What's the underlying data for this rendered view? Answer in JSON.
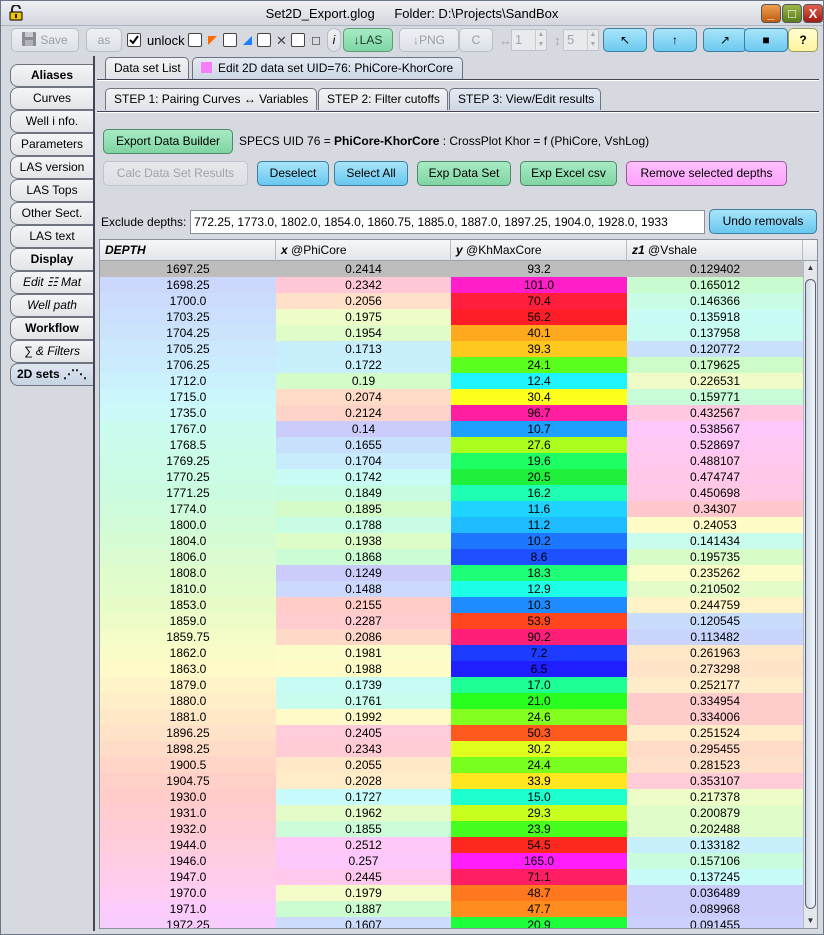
{
  "window": {
    "filename": "Set2D_Export.glog",
    "folder": "Folder: D:\\Projects\\SandBox",
    "controls": {
      "minimize": "_",
      "maximize": "□",
      "close": "X"
    }
  },
  "toolbar": {
    "save_label": "Save",
    "as_label": "as",
    "unlock_label": "unlock",
    "unlock_checked": true,
    "info_label": "i",
    "las_label": "↓LAS",
    "png_label": "↓PNG",
    "c_label": "C",
    "h_spin_icon": "↔",
    "h_spin_value": "1",
    "v_spin_icon": "↕",
    "v_spin_value": "5",
    "arrow_nw": "↖",
    "arrow_n": "↑",
    "arrow_ne": "↗",
    "square_outline": "□",
    "square_filled": "■",
    "help": "?"
  },
  "sidebar": {
    "items": [
      {
        "label": "Aliases",
        "style": "bold"
      },
      {
        "label": "Curves",
        "style": ""
      },
      {
        "label": "Well i nfo.",
        "style": ""
      },
      {
        "label": "Parameters",
        "style": ""
      },
      {
        "label": "LAS version",
        "style": ""
      },
      {
        "label": "LAS Tops",
        "style": ""
      },
      {
        "label": "Other Sect.",
        "style": ""
      },
      {
        "label": "LAS text",
        "style": ""
      },
      {
        "label": "Display",
        "style": "bold"
      },
      {
        "label": "Edit ☷ Mat",
        "style": "italic"
      },
      {
        "label": "Well path",
        "style": "italic"
      },
      {
        "label": "Workflow",
        "style": "bold"
      },
      {
        "label": "∑ & Filters",
        "style": "italic"
      },
      {
        "label": "2D sets ⋰⋱",
        "style": "bold",
        "selected": true
      }
    ]
  },
  "tabs": {
    "list_label": "Data set List",
    "edit_label": "Edit 2D data set UID=76: PhiCore-KhorCore",
    "edit_swatch_color": "#f77ef7"
  },
  "steps": {
    "step1": "STEP 1: Pairing Curves ↔ Variables",
    "step2": "STEP 2: Filter cutoffs",
    "step3": "STEP 3: View/Edit results"
  },
  "actions": {
    "export_builder": "Export Data Builder",
    "specs_prefix": "SPECS UID 76 = ",
    "specs_name": "PhiCore-KhorCore",
    "specs_suffix": " : CrossPlot Khor = f (PhiCore, VshLog)",
    "calc": "Calc Data Set Results",
    "deselect": "Deselect",
    "select_all": "Select All",
    "exp_data_set": "Exp Data Set",
    "exp_excel": "Exp Excel csv",
    "remove_selected": "Remove selected depths",
    "exclude_label": "Exclude depths:",
    "exclude_value": "772.25,  1773.0,  1802.0,  1854.0,  1860.75,  1885.0,  1887.0,  1897.25,  1904.0,  1928.0,  1933",
    "undo": "Undo removals"
  },
  "table": {
    "headers": [
      {
        "prefix": "DEPTH",
        "suffix": ""
      },
      {
        "prefix": "x",
        "suffix": " @PhiCore"
      },
      {
        "prefix": "y",
        "suffix": " @KhMaxCore"
      },
      {
        "prefix": "z1",
        "suffix": " @Vshale"
      }
    ],
    "rows": [
      {
        "depth": "1697.25",
        "x": "0.2414",
        "y": "93.2",
        "z": "0.129402",
        "dc": "#bdbdbd",
        "xc": "#bdbdbd",
        "yc": "#ff1e96",
        "zc": "#bdbdbd",
        "selected": true
      },
      {
        "depth": "1698.25",
        "x": "0.2342",
        "y": "101.0",
        "z": "0.165012",
        "dc": "#cbd8fc",
        "xc": "#ffc8d6",
        "yc": "#ff1ec8",
        "zc": "#c8fcd0"
      },
      {
        "depth": "1700.0",
        "x": "0.2056",
        "y": "70.4",
        "z": "0.146366",
        "dc": "#cbdcfc",
        "xc": "#ffe0c8",
        "yc": "#ff1e3c",
        "zc": "#c8fce4"
      },
      {
        "depth": "1703.25",
        "x": "0.1975",
        "y": "56.2",
        "z": "0.135918",
        "dc": "#cbe0fc",
        "xc": "#eefcc8",
        "yc": "#ff1e28",
        "zc": "#c8fcf4"
      },
      {
        "depth": "1704.25",
        "x": "0.1954",
        "y": "40.1",
        "z": "0.137958",
        "dc": "#cbe4fc",
        "xc": "#e0fcc8",
        "yc": "#ffaa1e",
        "zc": "#c8fcf0"
      },
      {
        "depth": "1705.25",
        "x": "0.1713",
        "y": "39.3",
        "z": "0.120772",
        "dc": "#cbe8fc",
        "xc": "#c8eefc",
        "yc": "#ffc81e",
        "zc": "#c8e0fc"
      },
      {
        "depth": "1706.25",
        "x": "0.1722",
        "y": "24.1",
        "z": "0.179625",
        "dc": "#cbecfc",
        "xc": "#c8f0fc",
        "yc": "#5aff1e",
        "zc": "#cefcc8"
      },
      {
        "depth": "1712.0",
        "x": "0.19",
        "y": "12.4",
        "z": "0.226531",
        "dc": "#cbf2fc",
        "xc": "#d4fcc8",
        "yc": "#1ef4ff",
        "zc": "#f0fcc8"
      },
      {
        "depth": "1715.0",
        "x": "0.2074",
        "y": "30.4",
        "z": "0.159771",
        "dc": "#cbf6fc",
        "xc": "#ffdcc8",
        "yc": "#ffff1e",
        "zc": "#c8fcd8"
      },
      {
        "depth": "1735.0",
        "x": "0.2124",
        "y": "96.7",
        "z": "0.432567",
        "dc": "#cbfaf8",
        "xc": "#ffd4c8",
        "yc": "#ff1ea0",
        "zc": "#ffc8e0"
      },
      {
        "depth": "1767.0",
        "x": "0.14",
        "y": "10.7",
        "z": "0.538567",
        "dc": "#cbfcf0",
        "xc": "#ccccfc",
        "yc": "#1ea0ff",
        "zc": "#ffc8fc"
      },
      {
        "depth": "1768.5",
        "x": "0.1655",
        "y": "27.6",
        "z": "0.528697",
        "dc": "#cbfcec",
        "xc": "#c8e0fc",
        "yc": "#aaff1e",
        "zc": "#ffc8f4"
      },
      {
        "depth": "1769.25",
        "x": "0.1704",
        "y": "19.6",
        "z": "0.488107",
        "dc": "#cbfce8",
        "xc": "#c8ecfc",
        "yc": "#1eff64",
        "zc": "#ffc8ec"
      },
      {
        "depth": "1770.25",
        "x": "0.1742",
        "y": "20.5",
        "z": "0.474747",
        "dc": "#cbfce4",
        "xc": "#c8fcf4",
        "yc": "#1ef03c",
        "zc": "#ffc8e8"
      },
      {
        "depth": "1771.25",
        "x": "0.1849",
        "y": "16.2",
        "z": "0.450698",
        "dc": "#cbfce0",
        "xc": "#c8fce0",
        "yc": "#1effb4",
        "zc": "#ffc8e4"
      },
      {
        "depth": "1774.0",
        "x": "0.1895",
        "y": "11.6",
        "z": "0.34307",
        "dc": "#cefcdc",
        "xc": "#d4fcc8",
        "yc": "#1ed4ff",
        "zc": "#ffc8cc"
      },
      {
        "depth": "1800.0",
        "x": "0.1788",
        "y": "11.2",
        "z": "0.24053",
        "dc": "#d2fcd8",
        "xc": "#c8fce4",
        "yc": "#1ebcff",
        "zc": "#fffcc8"
      },
      {
        "depth": "1804.0",
        "x": "0.1938",
        "y": "10.2",
        "z": "0.141434",
        "dc": "#d6fcd4",
        "xc": "#dcfcc8",
        "yc": "#1e78ff",
        "zc": "#c8fcec"
      },
      {
        "depth": "1806.0",
        "x": "0.1868",
        "y": "8.6",
        "z": "0.195735",
        "dc": "#dafcd0",
        "xc": "#ccfcd4",
        "yc": "#1e50ff",
        "zc": "#d8fcc8"
      },
      {
        "depth": "1808.0",
        "x": "0.1249",
        "y": "18.3",
        "z": "0.235262",
        "dc": "#defccc",
        "xc": "#ccccfc",
        "yc": "#1eff78",
        "zc": "#fcfcc8"
      },
      {
        "depth": "1810.0",
        "x": "0.1488",
        "y": "12.9",
        "z": "0.210502",
        "dc": "#e2fccc",
        "xc": "#ccd8fc",
        "yc": "#1effe8",
        "zc": "#e4fcc8"
      },
      {
        "depth": "1853.0",
        "x": "0.2155",
        "y": "10.3",
        "z": "0.244759",
        "dc": "#e8fcc8",
        "xc": "#ffccc8",
        "yc": "#1e8cff",
        "zc": "#fff4c8"
      },
      {
        "depth": "1859.0",
        "x": "0.2287",
        "y": "53.9",
        "z": "0.120545",
        "dc": "#eefcc8",
        "xc": "#ffccd0",
        "yc": "#ff461e",
        "zc": "#c8dcfc"
      },
      {
        "depth": "1859.75",
        "x": "0.2086",
        "y": "90.2",
        "z": "0.113482",
        "dc": "#f4fcc8",
        "xc": "#ffd8c8",
        "yc": "#ff1e78",
        "zc": "#c8d4fc"
      },
      {
        "depth": "1862.0",
        "x": "0.1981",
        "y": "7.2",
        "z": "0.261963",
        "dc": "#fafcc8",
        "xc": "#fcfcc8",
        "yc": "#1e3cff",
        "zc": "#ffe8c8"
      },
      {
        "depth": "1863.0",
        "x": "0.1988",
        "y": "6.5",
        "z": "0.273298",
        "dc": "#fffac8",
        "xc": "#fffcc8",
        "yc": "#1e1eff",
        "zc": "#ffe4c8"
      },
      {
        "depth": "1879.0",
        "x": "0.1739",
        "y": "17.0",
        "z": "0.252177",
        "dc": "#fff4c8",
        "xc": "#c8fcf4",
        "yc": "#1eff96",
        "zc": "#ffecc8"
      },
      {
        "depth": "1880.0",
        "x": "0.1761",
        "y": "21.0",
        "z": "0.334954",
        "dc": "#ffeec8",
        "xc": "#c8fcec",
        "yc": "#28ff1e",
        "zc": "#ffcccc"
      },
      {
        "depth": "1881.0",
        "x": "0.1992",
        "y": "24.6",
        "z": "0.334006",
        "dc": "#ffe8c8",
        "xc": "#fffac8",
        "yc": "#82ff1e",
        "zc": "#ffcccc"
      },
      {
        "depth": "1896.25",
        "x": "0.2405",
        "y": "50.3",
        "z": "0.251524",
        "dc": "#ffe2c8",
        "xc": "#ffccdc",
        "yc": "#ff5a1e",
        "zc": "#ffecc8"
      },
      {
        "depth": "1898.25",
        "x": "0.2343",
        "y": "30.2",
        "z": "0.295455",
        "dc": "#ffdcc8",
        "xc": "#ffccd6",
        "yc": "#e0ff1e",
        "zc": "#ffdcc8"
      },
      {
        "depth": "1900.5",
        "x": "0.2055",
        "y": "24.4",
        "z": "0.281523",
        "dc": "#ffd6c8",
        "xc": "#ffe8c8",
        "yc": "#78ff1e",
        "zc": "#ffe0c8"
      },
      {
        "depth": "1904.75",
        "x": "0.2028",
        "y": "33.9",
        "z": "0.353107",
        "dc": "#ffd0c8",
        "xc": "#ffecc8",
        "yc": "#ffe61e",
        "zc": "#ffccd8"
      },
      {
        "depth": "1930.0",
        "x": "0.1727",
        "y": "15.0",
        "z": "0.217378",
        "dc": "#ffccca",
        "xc": "#c8fcfc",
        "yc": "#1effd0",
        "zc": "#eefcc8"
      },
      {
        "depth": "1931.0",
        "x": "0.1962",
        "y": "29.3",
        "z": "0.200879",
        "dc": "#ffccd0",
        "xc": "#e4fcc8",
        "yc": "#c8ff1e",
        "zc": "#e0fcc8"
      },
      {
        "depth": "1932.0",
        "x": "0.1855",
        "y": "23.9",
        "z": "0.202488",
        "dc": "#ffccd6",
        "xc": "#ccfcd8",
        "yc": "#46ff1e",
        "zc": "#e0fcc8"
      },
      {
        "depth": "1944.0",
        "x": "0.2512",
        "y": "54.5",
        "z": "0.133182",
        "dc": "#ffccdc",
        "xc": "#ffc8f8",
        "yc": "#ff281e",
        "zc": "#c8f0fc"
      },
      {
        "depth": "1946.0",
        "x": "0.257",
        "y": "165.0",
        "z": "0.157106",
        "dc": "#ffcce4",
        "xc": "#fcc8fc",
        "yc": "#ff1ef8",
        "zc": "#c8fcdc"
      },
      {
        "depth": "1947.0",
        "x": "0.2445",
        "y": "71.1",
        "z": "0.137245",
        "dc": "#ffccec",
        "xc": "#ffc8ec",
        "yc": "#ff1e64",
        "zc": "#c8fcf8"
      },
      {
        "depth": "1970.0",
        "x": "0.1979",
        "y": "48.7",
        "z": "0.036489",
        "dc": "#ffccf4",
        "xc": "#f4fcc8",
        "yc": "#ff781e",
        "zc": "#ccccfc"
      },
      {
        "depth": "1971.0",
        "x": "0.1887",
        "y": "47.7",
        "z": "0.089968",
        "dc": "#fcccfc",
        "xc": "#ccfcd0",
        "yc": "#ff8c1e",
        "zc": "#ccccfc"
      },
      {
        "depth": "1972.25",
        "x": "0.1607",
        "y": "20.9",
        "z": "0.091455",
        "dc": "#f8ccfc",
        "xc": "#ccdcfc",
        "yc": "#1eff3c",
        "zc": "#ccd0fc"
      }
    ]
  }
}
